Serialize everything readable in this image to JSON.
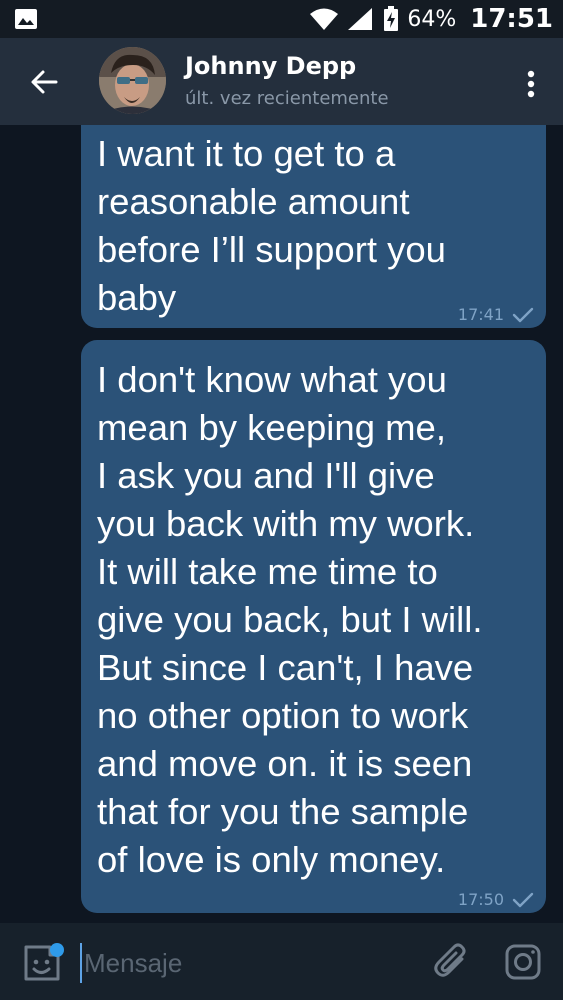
{
  "status_bar": {
    "battery": "64%",
    "time": "17:51",
    "icons": [
      "image-icon",
      "wifi-icon",
      "signal-icon",
      "battery-icon"
    ]
  },
  "header": {
    "contact_name": "Johnny Depp",
    "contact_status": "últ. vez recientemente",
    "icons": [
      "back-arrow-icon",
      "avatar",
      "more-vert-icon"
    ]
  },
  "messages": [
    {
      "text": "I want it to get to a\nreasonable amount\nbefore I’ll support you\nbaby",
      "time": "17:41",
      "status_icon": "check-icon"
    },
    {
      "text": "I don't know what you\nmean by keeping me,\nI ask you and I'll give\nyou back with my work.\nIt will take me time to\ngive you back, but I will.\nBut since I can't, I have\nno other option to work\nand move on. it is seen\nthat for you the sample\nof love is only money.",
      "time": "17:50",
      "status_icon": "check-icon"
    }
  ],
  "input_bar": {
    "placeholder": "Mensaje",
    "icons": [
      "sticker-icon",
      "attach-icon",
      "camera-icon"
    ]
  },
  "colors": {
    "background": "#0e1621",
    "header": "#242f3d",
    "bubble_out": "#2b5278",
    "input_bar": "#17212b",
    "accent": "#2f9bea",
    "check": "#7fa3c6"
  }
}
